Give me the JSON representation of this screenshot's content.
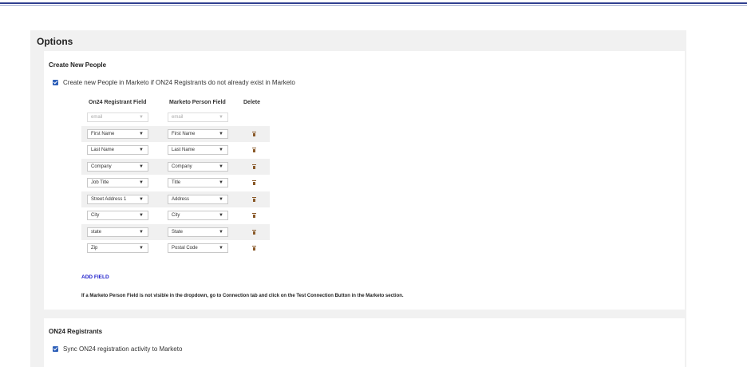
{
  "options": {
    "title": "Options",
    "create_new_people": {
      "title": "Create New People",
      "checkbox_label": "Create new People in Marketo if ON24 Registrants do not already exist in Marketo",
      "checked": true,
      "columns": [
        "On24 Registrant Field",
        "Marketo Person Field",
        "Delete"
      ],
      "rows": [
        {
          "on24": "email",
          "marketo": "email",
          "disabled": true
        },
        {
          "on24": "First Name",
          "marketo": "First Name"
        },
        {
          "on24": "Last Name",
          "marketo": "Last Name"
        },
        {
          "on24": "Company",
          "marketo": "Company"
        },
        {
          "on24": "Job Title",
          "marketo": "Title"
        },
        {
          "on24": "Street Address 1",
          "marketo": "Address"
        },
        {
          "on24": "City",
          "marketo": "City"
        },
        {
          "on24": "state",
          "marketo": "State"
        },
        {
          "on24": "Zip",
          "marketo": "Postal Code"
        }
      ],
      "add_field_label": "ADD FIELD",
      "hint": "If a Marketo Person Field is not visible in the dropdown, go to Connection tab and click on the Test Connection Button in the Marketo section."
    },
    "on24_registrants": {
      "title": "ON24 Registrants",
      "checkbox_label": "Sync ON24 registration activity to Marketo",
      "checked": true
    }
  },
  "icons": {
    "dropdown": "chevron-down-icon",
    "delete": "trash-icon",
    "check": "checkbox-checked-icon"
  },
  "colors": {
    "accent": "#2d5fb8",
    "link": "#2222cc",
    "trash": "#8a5a2a"
  }
}
